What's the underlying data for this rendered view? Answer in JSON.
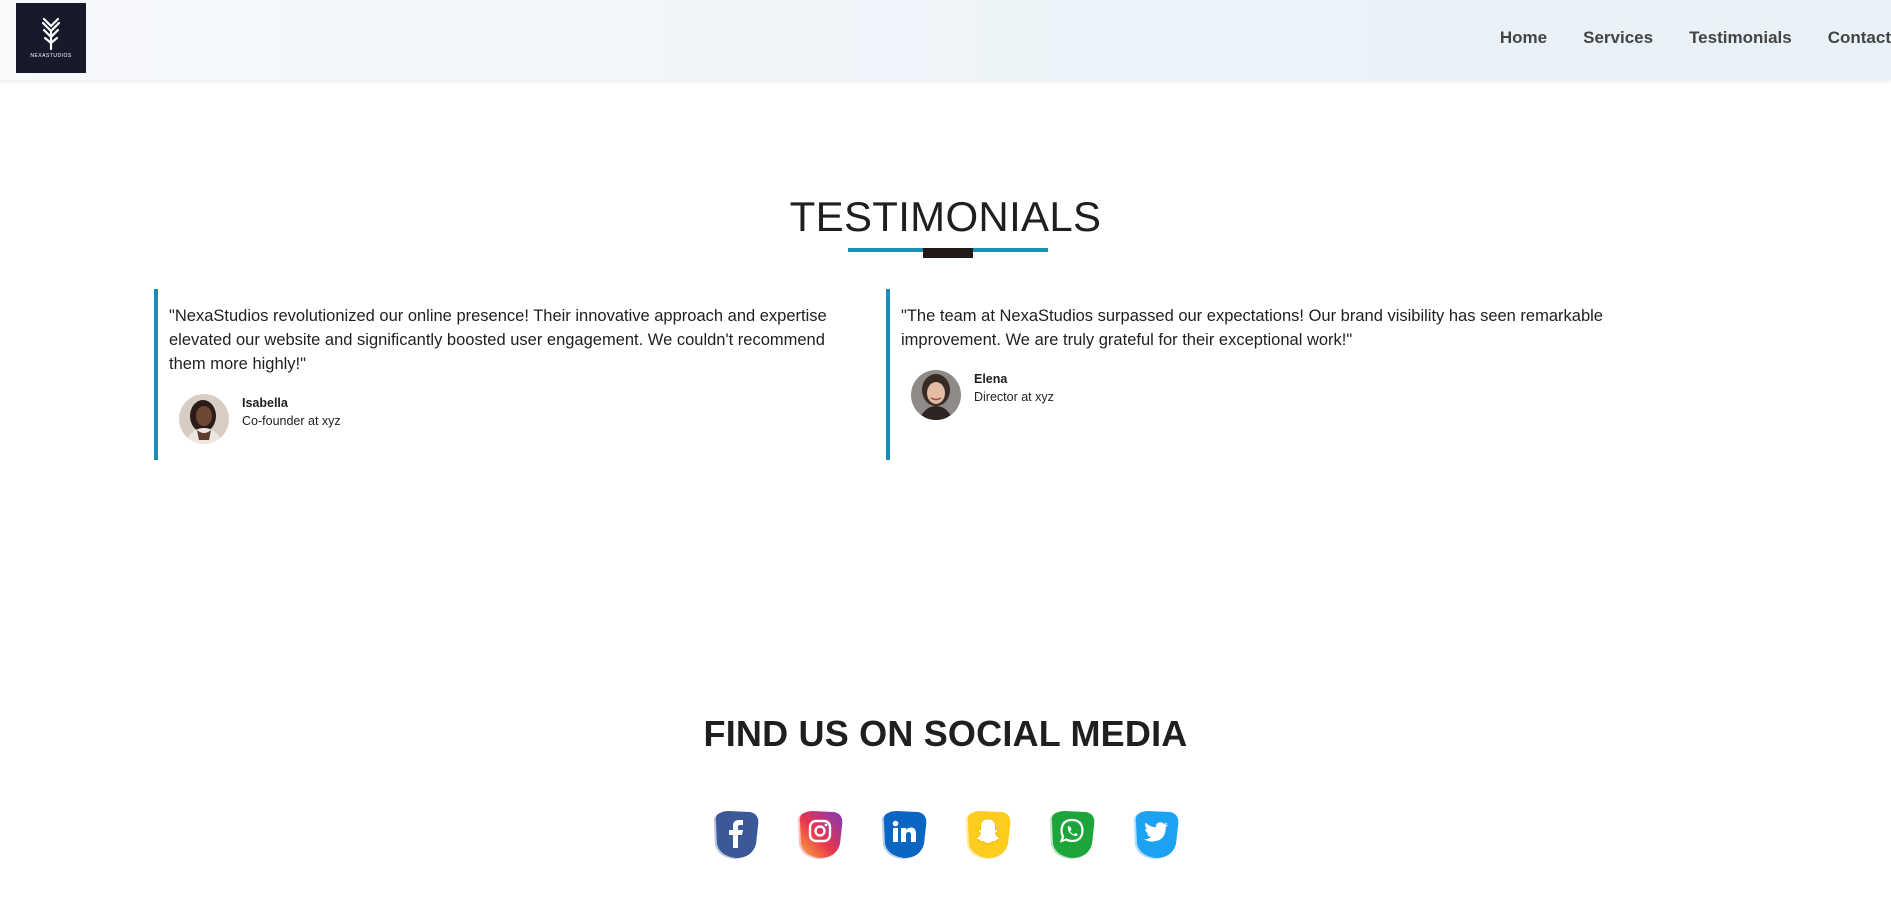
{
  "brand": {
    "logo_text": "NEXASTUDIOS"
  },
  "nav": {
    "items": [
      "Home",
      "Services",
      "Testimonials",
      "Contact"
    ]
  },
  "testimonials": {
    "title": "TESTIMONIALS",
    "items": [
      {
        "quote": "\"NexaStudios revolutionized our online presence! Their innovative approach and expertise elevated our website and significantly boosted user engagement. We couldn't recommend them more highly!\"",
        "name": "Isabella",
        "role": "Co-founder at xyz"
      },
      {
        "quote": "\"The team at NexaStudios surpassed our expectations! Our brand visibility has seen remarkable improvement. We are truly grateful for their exceptional work!\"",
        "name": "Elena",
        "role": "Director at xyz"
      }
    ]
  },
  "social": {
    "title": "FIND US ON SOCIAL MEDIA",
    "icons": [
      "facebook-icon",
      "instagram-icon",
      "linkedin-icon",
      "snapchat-icon",
      "whatsapp-icon",
      "twitter-icon"
    ]
  },
  "colors": {
    "accent": "#1a8cb5",
    "underline_accent": "#231a1a",
    "logo_bg": "#161a2b",
    "facebook": "#3b5998",
    "linkedin": "#0a66c2",
    "snapchat": "#fccc1f",
    "whatsapp": "#1ca53b",
    "twitter": "#1da1f2"
  }
}
